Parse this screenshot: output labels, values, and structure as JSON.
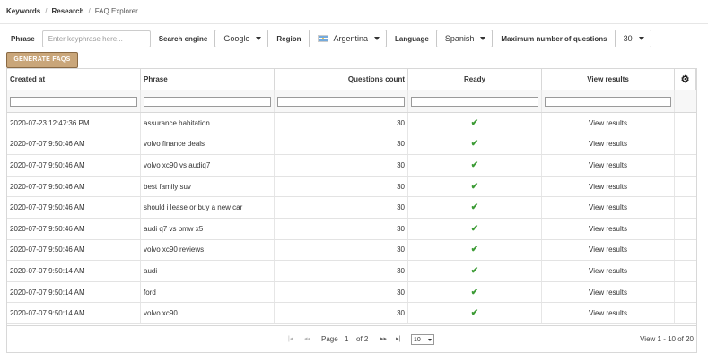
{
  "breadcrumb": {
    "item1": "Keywords",
    "item2": "Research",
    "item3": "FAQ Explorer"
  },
  "filters": {
    "phrase_label": "Phrase",
    "phrase_placeholder": "Enter keyphrase here...",
    "engine_label": "Search engine",
    "engine_value": "Google",
    "region_label": "Region",
    "region_value": "Argentina",
    "language_label": "Language",
    "language_value": "Spanish",
    "maxq_label": "Maximum number of questions",
    "maxq_value": "30"
  },
  "generate_label": "GENERATE FAQS",
  "table": {
    "headers": [
      "Created at",
      "Phrase",
      "Questions count",
      "Ready",
      "View results"
    ],
    "rows": [
      {
        "created": "2020-07-23 12:47:36 PM",
        "phrase": "assurance habitation",
        "count": "30",
        "link": "View results"
      },
      {
        "created": "2020-07-07 9:50:46 AM",
        "phrase": "volvo finance deals",
        "count": "30",
        "link": "View results"
      },
      {
        "created": "2020-07-07 9:50:46 AM",
        "phrase": "volvo xc90 vs audiq7",
        "count": "30",
        "link": "View results"
      },
      {
        "created": "2020-07-07 9:50:46 AM",
        "phrase": "best family suv",
        "count": "30",
        "link": "View results"
      },
      {
        "created": "2020-07-07 9:50:46 AM",
        "phrase": "should i lease or buy a new car",
        "count": "30",
        "link": "View results"
      },
      {
        "created": "2020-07-07 9:50:46 AM",
        "phrase": "audi q7 vs bmw x5",
        "count": "30",
        "link": "View results"
      },
      {
        "created": "2020-07-07 9:50:46 AM",
        "phrase": "volvo xc90 reviews",
        "count": "30",
        "link": "View results"
      },
      {
        "created": "2020-07-07 9:50:14 AM",
        "phrase": "audi",
        "count": "30",
        "link": "View results"
      },
      {
        "created": "2020-07-07 9:50:14 AM",
        "phrase": "ford",
        "count": "30",
        "link": "View results"
      },
      {
        "created": "2020-07-07 9:50:14 AM",
        "phrase": "volvo xc90",
        "count": "30",
        "link": "View results"
      }
    ]
  },
  "pager": {
    "page_label": "Page",
    "page_value": "1",
    "of_label": "of 2",
    "page_size": "10",
    "view_info": "View 1 - 10 of 20"
  },
  "colors": {
    "generate_button": "#c9a67a",
    "check": "#3c9b35"
  }
}
